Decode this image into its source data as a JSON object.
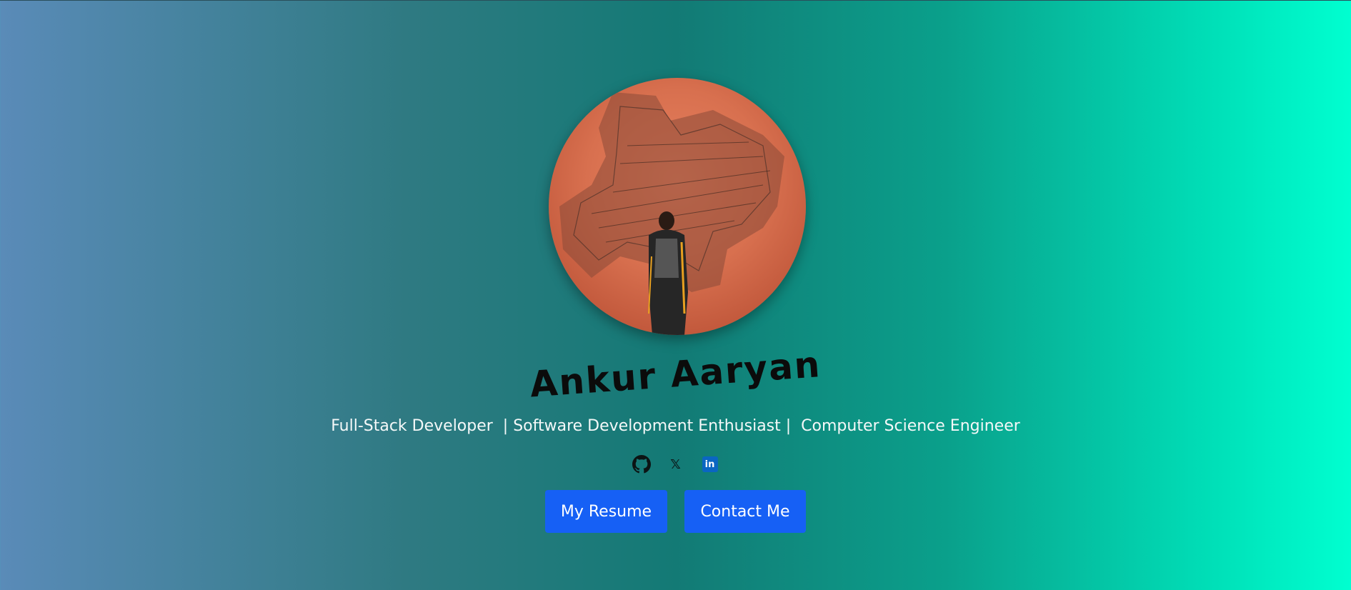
{
  "profile": {
    "name": "Ankur Aaryan",
    "tagline": "Full-Stack Developer  | Software Development Enthusiast |  Computer Science Engineer",
    "avatar_icon": "profile-photo"
  },
  "socials": [
    {
      "icon": "github-icon",
      "label": "GitHub"
    },
    {
      "icon": "x-icon",
      "label": "X"
    },
    {
      "icon": "linkedin-icon",
      "label": "in"
    }
  ],
  "actions": {
    "resume_label": "My Resume",
    "contact_label": "Contact Me"
  },
  "colors": {
    "button": "#1660f5",
    "linkedin": "#0a66c2",
    "name_text": "#0b0b0b",
    "tagline_text": "#f4f8f8"
  }
}
